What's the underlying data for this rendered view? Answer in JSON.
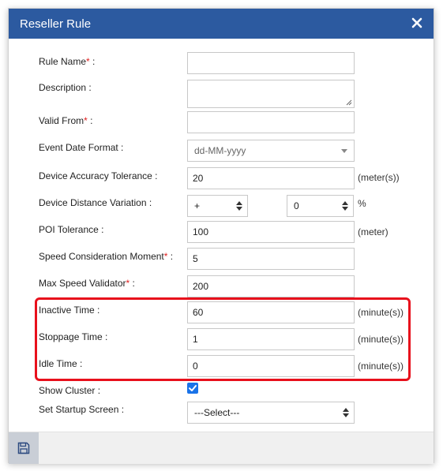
{
  "dialog": {
    "title": "Reseller Rule",
    "close_icon": "close-icon"
  },
  "fields": {
    "rule_name": {
      "label": "Rule Name",
      "required": "*",
      "suffix": " :",
      "value": ""
    },
    "description": {
      "label": "Description :",
      "value": ""
    },
    "valid_from": {
      "label": "Valid From",
      "required": "*",
      "suffix": " :",
      "value": ""
    },
    "event_date_format": {
      "label": "Event Date Format :",
      "selected": "dd-MM-yyyy"
    },
    "device_accuracy_tolerance": {
      "label": "Device Accuracy Tolerance :",
      "value": "20",
      "unit": "(meter(s))"
    },
    "device_distance_variation": {
      "label": "Device Distance Variation :",
      "sign": "+",
      "amount": "0",
      "unit": "%"
    },
    "poi_tolerance": {
      "label": "POI Tolerance :",
      "value": "100",
      "unit": "(meter)"
    },
    "speed_consideration_moment": {
      "label": "Speed Consideration Moment",
      "required": "*",
      "suffix": " :",
      "value": "5"
    },
    "max_speed_validator": {
      "label": "Max Speed Validator",
      "required": "*",
      "suffix": " :",
      "value": "200"
    },
    "inactive_time": {
      "label": "Inactive Time :",
      "value": "60",
      "unit": "(minute(s))"
    },
    "stoppage_time": {
      "label": "Stoppage Time :",
      "value": "1",
      "unit": "(minute(s))"
    },
    "idle_time": {
      "label": "Idle Time :",
      "value": "0",
      "unit": "(minute(s))"
    },
    "show_cluster": {
      "label": "Show Cluster :",
      "checked": true
    },
    "set_startup_screen": {
      "label": "Set Startup Screen :",
      "selected": "---Select---"
    }
  },
  "footer": {
    "save_icon": "save-icon"
  },
  "colors": {
    "title_bar": "#2c5aa0",
    "required_asterisk": "#e02020",
    "highlight_border": "#e8101c",
    "checkbox": "#1a73e8"
  }
}
